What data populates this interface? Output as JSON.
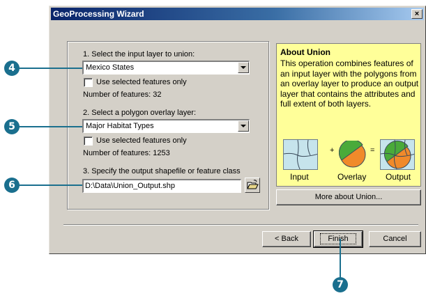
{
  "window": {
    "title": "GeoProcessing Wizard",
    "close_glyph": "×"
  },
  "step1": {
    "label": "1. Select the input layer to union:",
    "selected_layer": "Mexico States",
    "checkbox_label": "Use selected features only",
    "feature_count": "Number of features: 32"
  },
  "step2": {
    "label": "2. Select a polygon overlay layer:",
    "selected_layer": "Major Habitat Types",
    "checkbox_label": "Use selected features only",
    "feature_count": "Number of features: 1253"
  },
  "step3": {
    "label": "3. Specify the output shapefile or feature class",
    "output_path": "D:\\Data\\Union_Output.shp",
    "browse_icon": "open-folder-icon"
  },
  "about": {
    "heading": "About Union",
    "description": "This operation combines features of an input layer with the polygons from an overlay layer to produce an output layer that contains the attributes and full extent of both layers.",
    "figure": {
      "input_label": "Input",
      "plus": "+",
      "overlay_label": "Overlay",
      "equals": "=",
      "output_label": "Output"
    },
    "more_button": "More about Union..."
  },
  "buttons": {
    "back": "< Back",
    "finish": "Finish",
    "cancel": "Cancel"
  },
  "callouts": [
    "4",
    "5",
    "6",
    "7"
  ],
  "colors": {
    "callout": "#1a6f8e",
    "titlebar": "#0a246a",
    "about_bg": "#ffff99",
    "dialog": "#d4d0c8"
  }
}
